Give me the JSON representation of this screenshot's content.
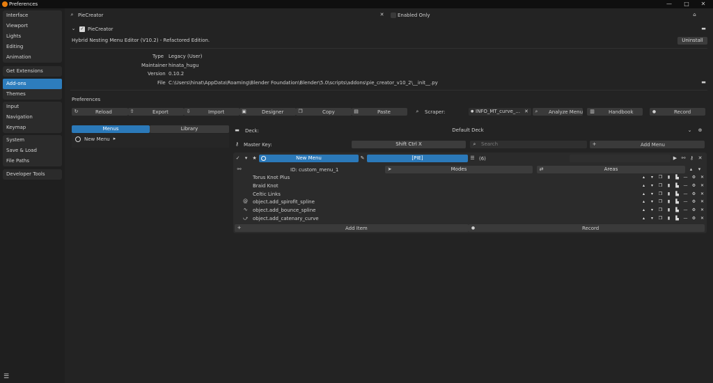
{
  "window": {
    "title": "Preferences"
  },
  "sidebar": {
    "group1": [
      "Interface",
      "Viewport",
      "Lights",
      "Editing",
      "Animation"
    ],
    "group2": [
      "Get Extensions"
    ],
    "group3": [
      "Add-ons",
      "Themes"
    ],
    "group4": [
      "Input",
      "Navigation",
      "Keymap"
    ],
    "group5": [
      "System",
      "Save & Load",
      "File Paths"
    ],
    "group6": [
      "Developer Tools"
    ]
  },
  "search": {
    "value": "PieCreator",
    "enabled_only": "Enabled Only"
  },
  "addon": {
    "name": "PieCreator",
    "description": "Hybrid Nesting Menu Editor (V10.2) - Refactored Edition.",
    "uninstall": "Uninstall",
    "info": {
      "type_label": "Type",
      "type_value": "Legacy (User)",
      "maintainer_label": "Maintainer",
      "maintainer_value": "hinata_hugu",
      "version_label": "Version",
      "version_value": "0.10.2",
      "file_label": "File",
      "file_value": "C:\\Users\\hinat\\AppData\\Roaming\\Blender Foundation\\Blender\\5.0\\scripts\\addons\\pie_creator_v10_2\\__init__.py"
    }
  },
  "prefs": {
    "heading": "Preferences",
    "toolbar": [
      "Reload",
      "Export",
      "Import",
      "Designer",
      "Copy",
      "Paste"
    ],
    "scraper_label": "Scraper:",
    "scraper_value": "INFO_MT_curve_...",
    "analyze": "Analyze Menu",
    "handbook": "Handbook",
    "record": "Record"
  },
  "left_panel": {
    "tab_menus": "Menus",
    "tab_library": "Library",
    "new_menu": "New Menu"
  },
  "deck": {
    "label": "Deck:",
    "value": "Default Deck",
    "master_key_label": "Master Key:",
    "master_key_value": "Shift Ctrl X",
    "search_placeholder": "Search",
    "add_menu": "Add Menu"
  },
  "menu": {
    "name": "New Menu",
    "type": "[PIE]",
    "count": "(6)",
    "id": "ID: custom_menu_1",
    "modes": "Modes",
    "areas": "Areas",
    "items": [
      "Torus Knot Plus",
      "Braid Knot",
      "Celtic Links",
      "object.add_spirofit_spline",
      "object.add_bounce_spline",
      "object.add_catenary_curve"
    ],
    "add_item": "Add Item",
    "record": "Record"
  },
  "colors": {
    "accent": "#2b79b9",
    "sidebar_active": "#2d7dbd"
  }
}
